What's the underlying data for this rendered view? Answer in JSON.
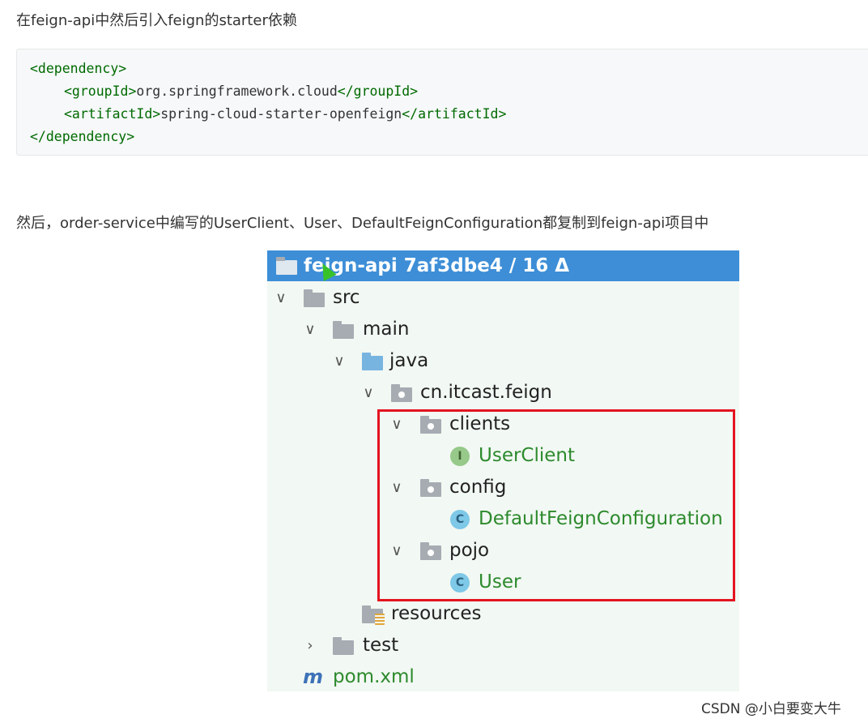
{
  "intro_text": "在feign-api中然后引入feign的starter依赖",
  "code": {
    "open_tag": "<dependency>",
    "group_open": "<groupId>",
    "group_value": "org.springframework.cloud",
    "group_close": "</groupId>",
    "artifact_open": "<artifactId>",
    "artifact_value": "spring-cloud-starter-openfeign",
    "artifact_close": "</artifactId>",
    "close_tag": "</dependency>"
  },
  "second_text": "然后，order-service中编写的UserClient、User、DefaultFeignConfiguration都复制到feign-api项目中",
  "tree": {
    "header": "feign-api  7af3dbe4 / 16 Δ",
    "src": "src",
    "main": "main",
    "java": "java",
    "package": "cn.itcast.feign",
    "clients": "clients",
    "user_client": "UserClient",
    "config": "config",
    "default_config": "DefaultFeignConfiguration",
    "pojo": "pojo",
    "user": "User",
    "resources": "resources",
    "test": "test",
    "pom": "pom.xml",
    "interface_badge": "I",
    "class_badge": "C",
    "maven_badge": "m"
  },
  "watermark": "CSDN @小白要变大牛",
  "colors": {
    "header_bg": "#3d8ed7",
    "highlight_border": "#e3141f",
    "code_tag": "#006a00",
    "tree_green": "#2d8a2d"
  }
}
